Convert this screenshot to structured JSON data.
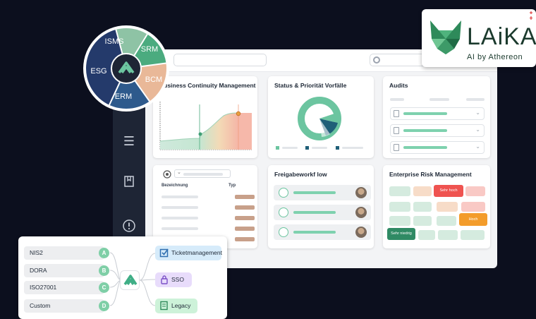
{
  "wheel": {
    "segments": [
      "ISMS",
      "SRM",
      "BCM",
      "ERM",
      "ESG"
    ],
    "colors": {
      "ISMS": "#8ec3a5",
      "SRM": "#4bab7f",
      "BCM": "#e9b898",
      "ERM": "#2e5a8c",
      "ESG": "#243a6b"
    }
  },
  "logo": {
    "title": "LAiKA",
    "subtitle": "AI by Athereon"
  },
  "cards": {
    "bcm": {
      "title": "Business Continuity Management"
    },
    "status": {
      "title": "Status & Priorität Vorfälle"
    },
    "audits": {
      "title": "Audits"
    },
    "table": {
      "col1": "Bezeichnung",
      "col2": "Typ"
    },
    "freigabe": {
      "title": "Freigabeworkf low"
    },
    "erm": {
      "title": "Enterprise Risk Management",
      "high_label": "Sehr hoch",
      "mid_label": "Hoch",
      "low_label": "Sehr niedrig"
    }
  },
  "integrations": {
    "sources": [
      {
        "label": "NIS2",
        "letter": "A"
      },
      {
        "label": "DORA",
        "letter": "B"
      },
      {
        "label": "ISO27001",
        "letter": "C"
      },
      {
        "label": "Custom",
        "letter": "D"
      }
    ],
    "targets": [
      {
        "label": "Ticketmanagement",
        "icon": "checkbox-icon",
        "color": "#d6ebfa"
      },
      {
        "label": "SSO",
        "icon": "lock-icon",
        "color": "#e8dcfb"
      },
      {
        "label": "Legacy",
        "icon": "document-icon",
        "color": "#cdf2d9"
      }
    ]
  },
  "colors": {
    "accent_green": "#6cc5a0",
    "dark_teal": "#1f5f78",
    "risk_red": "#ef5350",
    "risk_orange": "#f39c2b",
    "risk_dark_green": "#2f8a64"
  }
}
